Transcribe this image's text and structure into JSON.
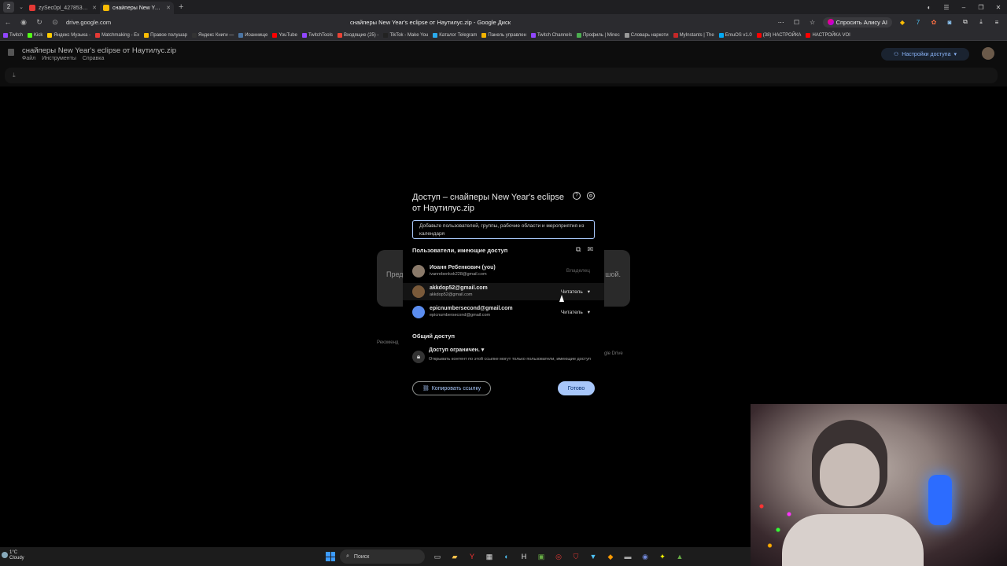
{
  "browser": {
    "workspace": "2",
    "tabs": [
      {
        "title": "zySec0pl_427853 | Consol",
        "fav": "#e53935",
        "active": false
      },
      {
        "title": "снайперы New Year's e",
        "fav": "#fbbc04",
        "active": true
      }
    ],
    "url": "drive.google.com",
    "page_title": "снайперы New Year's eclipse от Наутилус.zip - Google Диск",
    "alice_label": "Спросить Алису AI",
    "bookmarks": [
      {
        "label": "Twitch",
        "color": "#9146ff"
      },
      {
        "label": "Kick",
        "color": "#53fc18"
      },
      {
        "label": "Яндекс Музыка -",
        "color": "#ffcc00"
      },
      {
        "label": "Matchmaking - Ex",
        "color": "#e53935"
      },
      {
        "label": "Правое полушар",
        "color": "#fbbc04"
      },
      {
        "label": "Яндекс Книги —",
        "color": "#333"
      },
      {
        "label": "Иоаннище",
        "color": "#4c75a3"
      },
      {
        "label": "YouTube",
        "color": "#ff0000"
      },
      {
        "label": "TwitchTools",
        "color": "#9146ff"
      },
      {
        "label": "Входящие (25) -",
        "color": "#ea4335"
      },
      {
        "label": "TikTok - Make You",
        "color": "#222"
      },
      {
        "label": "Каталог Telegram",
        "color": "#2aabee"
      },
      {
        "label": "Панель управлен",
        "color": "#f4b400"
      },
      {
        "label": "Twitch Channels",
        "color": "#9146ff"
      },
      {
        "label": "Профиль | Minec",
        "color": "#4caf50"
      },
      {
        "label": "Словарь наркоти",
        "color": "#999"
      },
      {
        "label": "MyInstants | The",
        "color": "#c62828"
      },
      {
        "label": "EmuOS v1.0",
        "color": "#03a9f4"
      },
      {
        "label": "(38) НАСТРОЙКА",
        "color": "#ff0000"
      },
      {
        "label": "НАСТРОЙКА VOI",
        "color": "#ff0000"
      }
    ]
  },
  "doc": {
    "title": "снайперы New Year's eclipse от Наутилус.zip",
    "menu": [
      "Файл",
      "Инструменты",
      "Справка"
    ],
    "access_button": "Настройки доступа",
    "bg_left": "Пред",
    "bg_right": "шой.",
    "bg_label_left": "Рекоменд",
    "bg_label_right": "gle Drive"
  },
  "dialog": {
    "title": "Доступ – снайперы New Year's eclipse от Наутилус.zip",
    "input_placeholder": "Добавьте пользователей, группы, рабочие области и мероприятия из календаря",
    "people_header": "Пользователи, имеющие доступ",
    "users": [
      {
        "name": "Иоанн Ребенкович (you)",
        "email": "ivanrebenkok228@gmail.com",
        "role": "Владелец",
        "avatar": "#8a7a6a"
      },
      {
        "name": "akkdop52@gmail.com",
        "email": "akkdop52@gmail.com",
        "role": "Читатель",
        "avatar": "#7a5a3a"
      },
      {
        "name": "epicnumbersecond@gmail.com",
        "email": "epicnumbersecond@gmail.com",
        "role": "Читатель",
        "avatar": "#5b8def"
      }
    ],
    "general_header": "Общий доступ",
    "general_value": "Доступ ограничен.",
    "general_desc": "Открывать контент по этой ссылке могут только пользователи, имеющие доступ",
    "copy_link": "Копировать ссылку",
    "done": "Готово"
  },
  "taskbar": {
    "temp": "1°C",
    "weather": "Cloudy",
    "search": "Поиск"
  }
}
